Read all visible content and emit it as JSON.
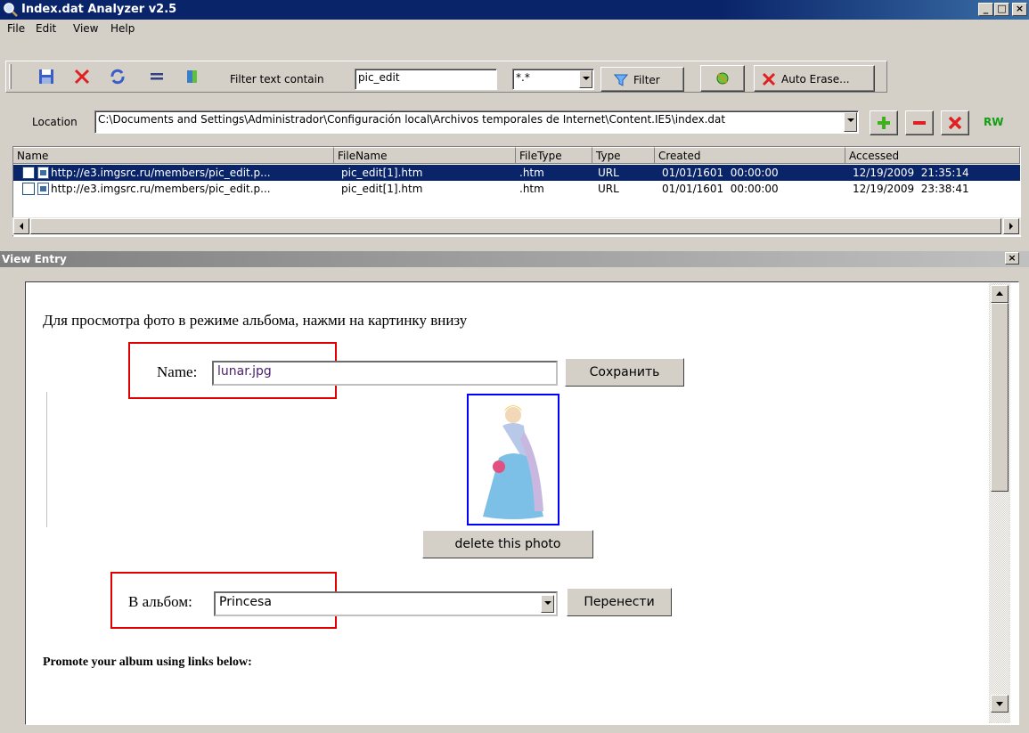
{
  "window": {
    "title": "Index.dat Analyzer v2.5"
  },
  "menu": [
    "File",
    "Edit",
    "View",
    "Help"
  ],
  "toolbar": {
    "filter_label": "Filter text contain",
    "filter_value": "pic_edit",
    "ext_value": "*.*",
    "filter_button": "Filter",
    "auto_erase_button": "Auto Erase..."
  },
  "location": {
    "label": "Location",
    "path": "C:\\Documents and Settings\\Administrador\\Configuración local\\Archivos temporales de Internet\\Content.IE5\\index.dat",
    "rw_label": "RW"
  },
  "table": {
    "columns": [
      "Name",
      "FileName",
      "FileType",
      "Type",
      "Created",
      "Accessed"
    ],
    "rows": [
      {
        "name": "http://e3.imgsrc.ru/members/pic_edit.p...",
        "filename": "pic_edit[1].htm",
        "filetype": ".htm",
        "type": "URL",
        "created": "01/01/1601  00:00:00",
        "accessed": "12/19/2009  21:35:14"
      },
      {
        "name": "http://e3.imgsrc.ru/members/pic_edit.p...",
        "filename": "pic_edit[1].htm",
        "filetype": ".htm",
        "type": "URL",
        "created": "01/01/1601  00:00:00",
        "accessed": "12/19/2009  23:38:41"
      }
    ]
  },
  "panel": {
    "title": "View Entry"
  },
  "webpage": {
    "intro": "Для просмотра фото в режиме альбома, нажми на картинку внизу",
    "name_label": "Name:",
    "name_value": "lunar.jpg",
    "save_button": "Сохранить",
    "delete_button": "delete this photo",
    "album_label": "В альбом:",
    "album_value": "Princesa",
    "move_button": "Перенести",
    "promote_text": "Promote your album using links below:"
  },
  "colors": {
    "titlebar": "#0a246a",
    "selection": "#0a246a",
    "highlight_box": "#e00000",
    "image_border": "#0000ff"
  }
}
